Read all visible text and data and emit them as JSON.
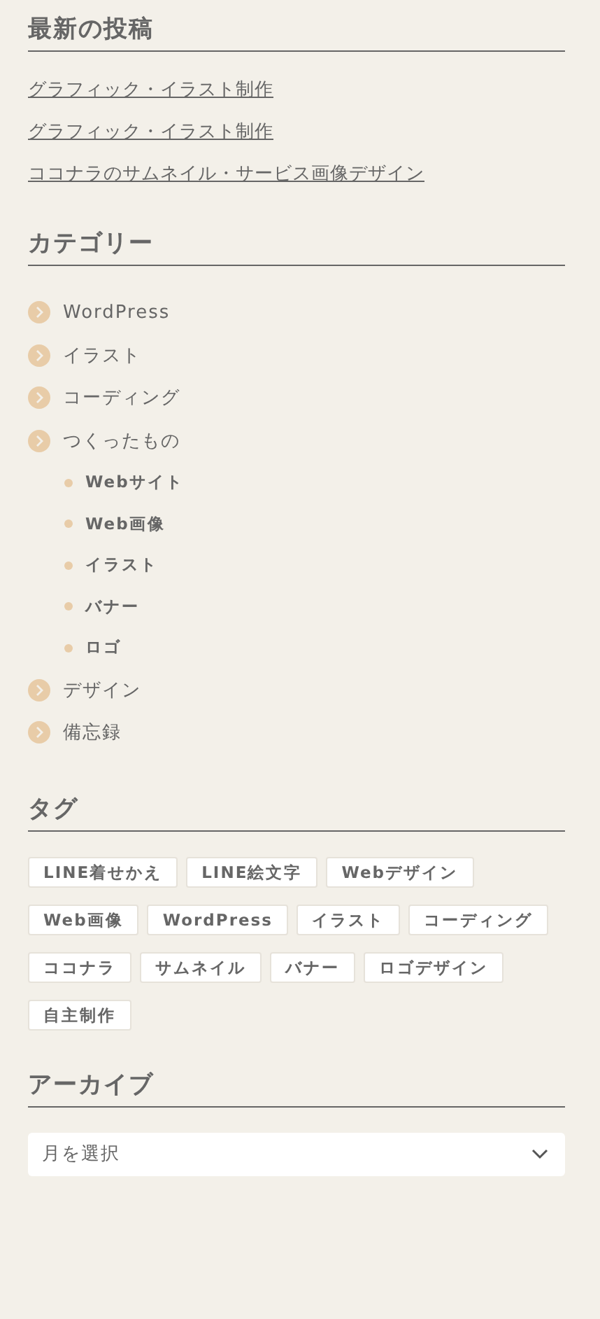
{
  "recent_posts": {
    "title": "最新の投稿",
    "items": [
      {
        "label": "グラフィック・イラスト制作"
      },
      {
        "label": "グラフィック・イラスト制作"
      },
      {
        "label": "ココナラのサムネイル・サービス画像デザイン"
      }
    ]
  },
  "categories": {
    "title": "カテゴリー",
    "items": [
      {
        "label": "WordPress"
      },
      {
        "label": "イラスト"
      },
      {
        "label": "コーディング"
      },
      {
        "label": "つくったもの",
        "children": [
          {
            "label": "Webサイト"
          },
          {
            "label": "Web画像"
          },
          {
            "label": "イラスト"
          },
          {
            "label": "バナー"
          },
          {
            "label": "ロゴ"
          }
        ]
      },
      {
        "label": "デザイン"
      },
      {
        "label": "備忘録"
      }
    ]
  },
  "tags": {
    "title": "タグ",
    "items": [
      "LINE着せかえ",
      "LINE絵文字",
      "Webデザイン",
      "Web画像",
      "WordPress",
      "イラスト",
      "コーディング",
      "ココナラ",
      "サムネイル",
      "バナー",
      "ロゴデザイン",
      "自主制作"
    ]
  },
  "archive": {
    "title": "アーカイブ",
    "select": {
      "value": "月を選択"
    }
  }
}
